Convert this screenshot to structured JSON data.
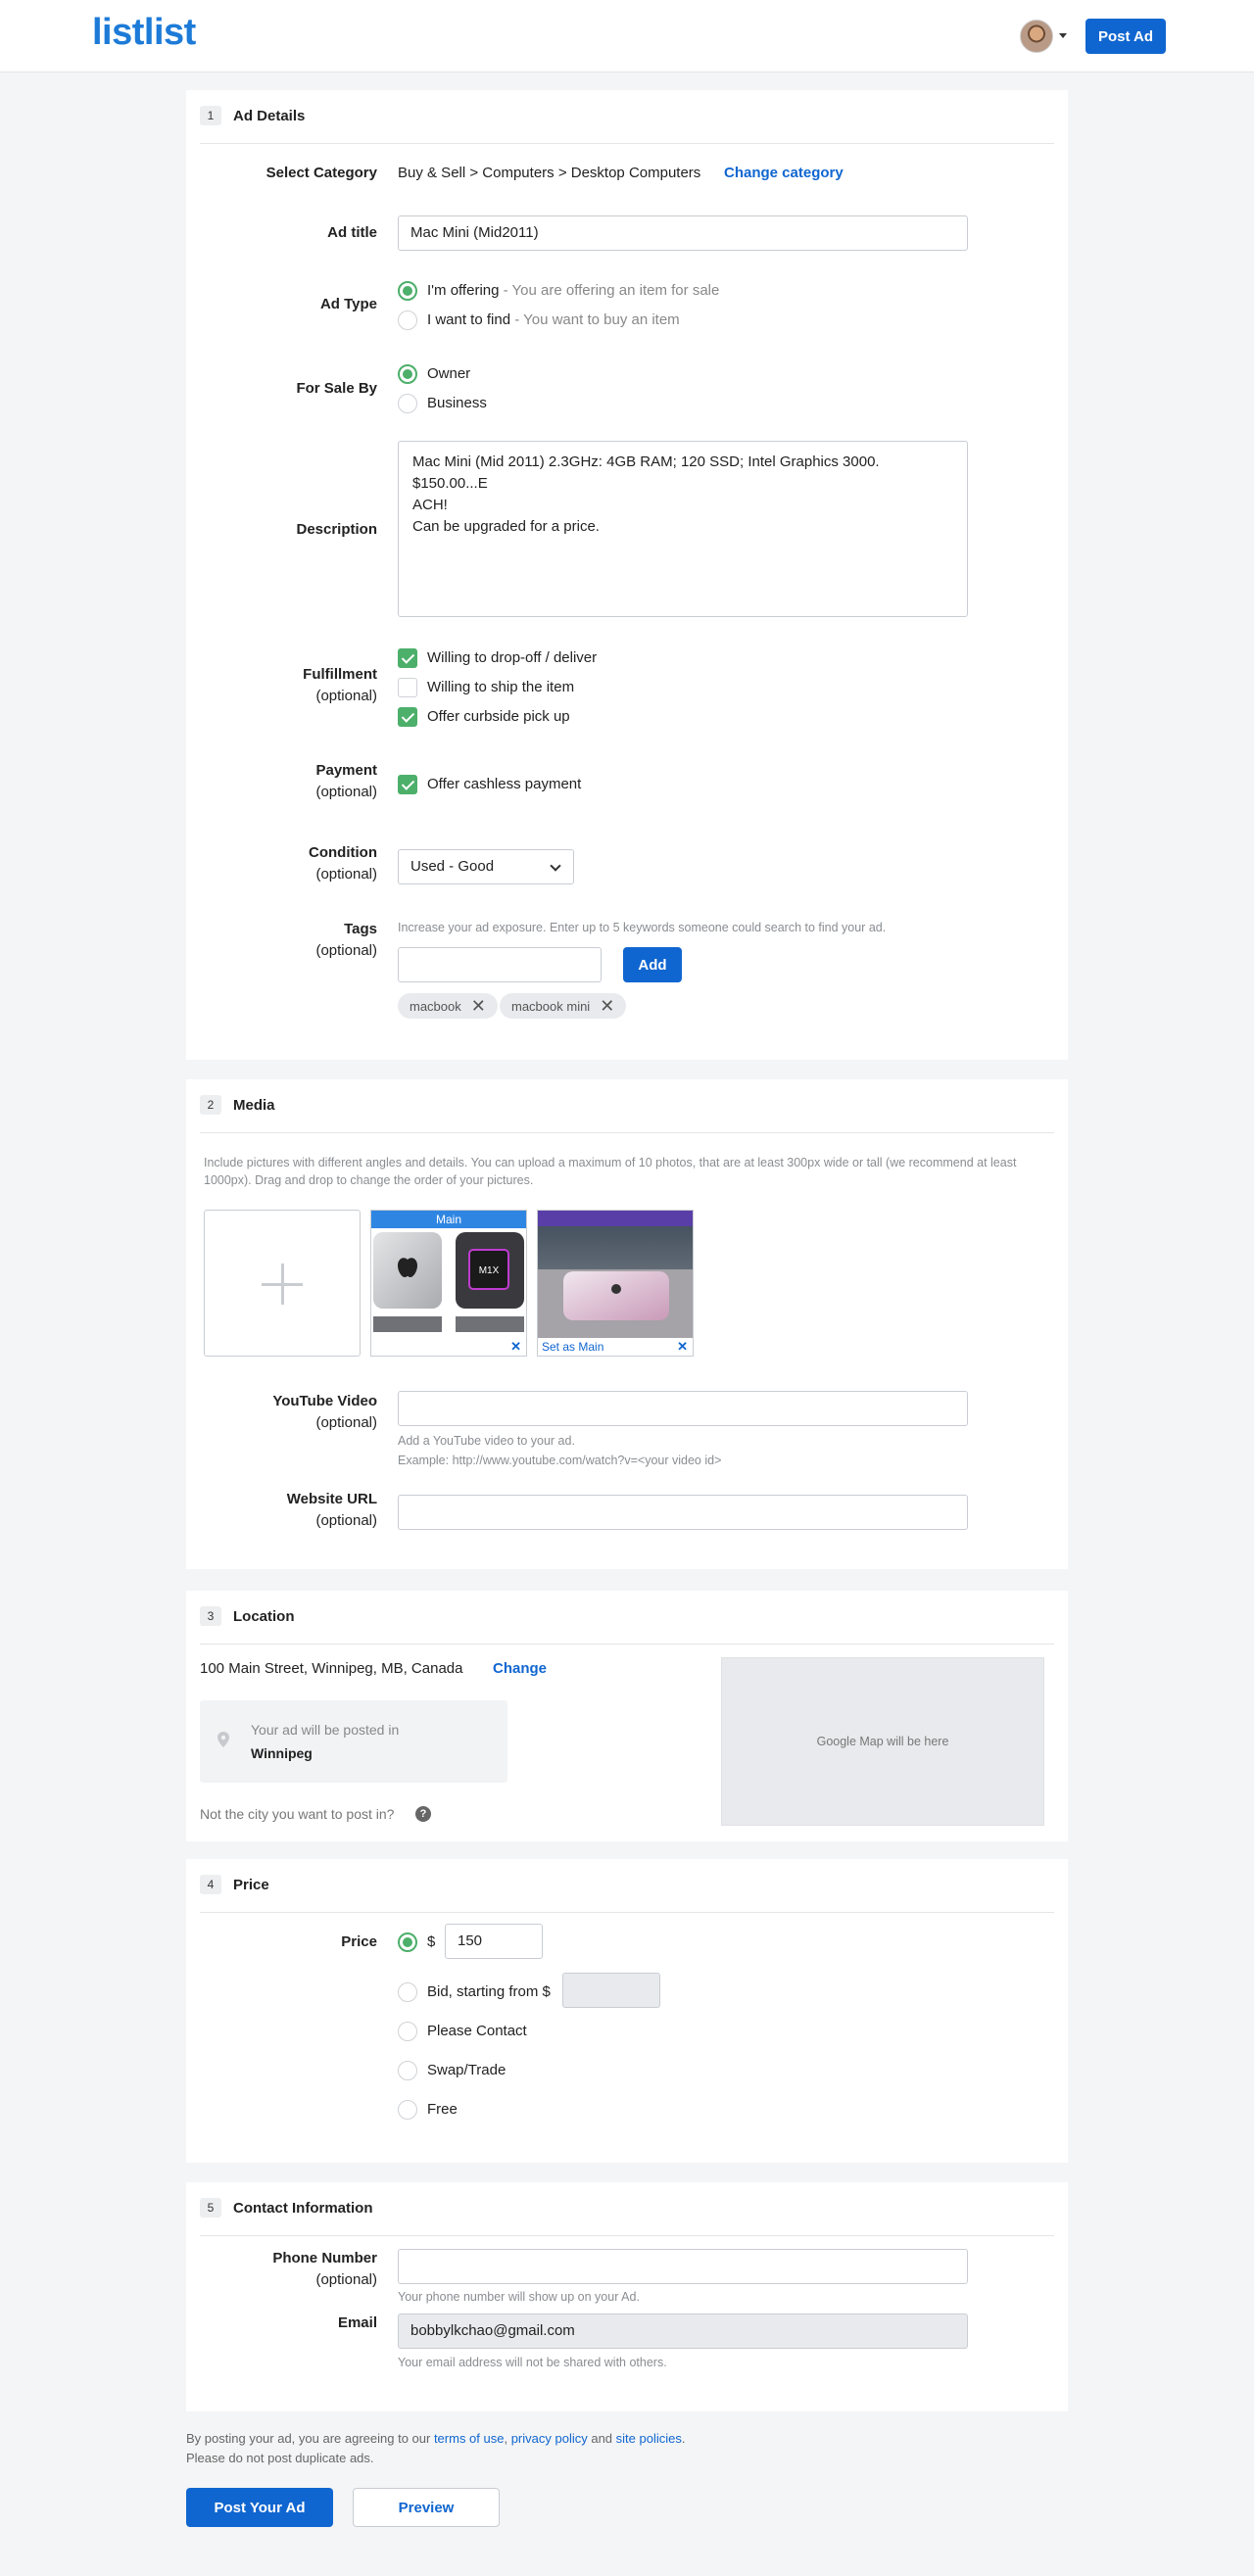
{
  "header": {
    "logo": "listlist",
    "post_ad_label": "Post Ad"
  },
  "ad_details": {
    "number": "1",
    "title": "Ad Details",
    "category_label": "Select Category",
    "category_value": "Buy & Sell > Computers > Desktop Computers",
    "change_category_label": "Change category",
    "ad_title_label": "Ad title",
    "ad_title_value": "Mac Mini (Mid2011)",
    "ad_type_label": "Ad Type",
    "ad_type_options": [
      {
        "label": "I'm offering",
        "hint": " - You are offering an item for sale",
        "selected": true
      },
      {
        "label": "I want to find",
        "hint": " - You want to buy an item",
        "selected": false
      }
    ],
    "sale_by_label": "For Sale By",
    "sale_by_options": [
      {
        "label": "Owner",
        "selected": true
      },
      {
        "label": "Business",
        "selected": false
      }
    ],
    "description_label": "Description",
    "description_value": "Mac Mini (Mid 2011) 2.3GHz: 4GB RAM; 120 SSD; Intel Graphics 3000. $150.00...E\nACH!\nCan be upgraded for a price.",
    "fulfillment_label": "Fulfillment",
    "optional_label": "(optional)",
    "fulfillment_options": [
      {
        "label": "Willing to drop-off / deliver",
        "checked": true
      },
      {
        "label": "Willing to ship the item",
        "checked": false
      },
      {
        "label": "Offer curbside pick up",
        "checked": true
      }
    ],
    "payment_label": "Payment",
    "payment_option": {
      "label": "Offer cashless payment",
      "checked": true
    },
    "condition_label": "Condition",
    "condition_value": "Used - Good",
    "tags_label": "Tags",
    "tags_hint": "Increase your ad exposure. Enter up to 5 keywords someone could search to find your ad.",
    "tags_add_label": "Add",
    "tags": [
      "macbook",
      "macbook mini"
    ]
  },
  "media": {
    "number": "2",
    "title": "Media",
    "hint": "Include pictures with different angles and details. You can upload a maximum of 10 photos, that are at least 300px wide or tall (we recommend at least 1000px). Drag and drop to change the order of your pictures.",
    "main_label": "Main",
    "set_main_label": "Set as Main",
    "chip_text": "M1X",
    "youtube_label": "YouTube Video",
    "youtube_hint_1": "Add a YouTube video to your ad.",
    "youtube_hint_2": "Example: http://www.youtube.com/watch?v=<your video id>",
    "website_label": "Website URL",
    "optional_label": "(optional)"
  },
  "location": {
    "number": "3",
    "title": "Location",
    "address": "100 Main Street, Winnipeg, MB, Canada",
    "change_label": "Change",
    "posted_in_label": "Your ad will be posted in",
    "city": "Winnipeg",
    "not_city_label": "Not the city you want to post in?",
    "map_placeholder": "Google Map will be here"
  },
  "price": {
    "number": "4",
    "title": "Price",
    "label": "Price",
    "currency": "$",
    "value": "150",
    "bid_label": "Bid, starting from $",
    "options": [
      "Please Contact",
      "Swap/Trade",
      "Free"
    ]
  },
  "contact": {
    "number": "5",
    "title": "Contact Information",
    "phone_label": "Phone Number",
    "optional_label": "(optional)",
    "phone_hint": "Your phone number will show up on your Ad.",
    "email_label": "Email",
    "email_value": "bobbylkchao@gmail.com",
    "email_hint": "Your email address will not be shared with others."
  },
  "footer": {
    "agree_prefix": "By posting your ad, you are agreeing to our ",
    "terms_link": "terms of use",
    "comma": ", ",
    "privacy_link": "privacy policy",
    "and": " and ",
    "site_link": "site policies",
    "period": ".",
    "duplicate_note": "Please do not post duplicate ads.",
    "post_button": "Post Your Ad",
    "preview_button": "Preview"
  },
  "colors": {
    "accent": "#1066d0",
    "logo": "#1d7bd8",
    "check": "#4caf6a"
  }
}
